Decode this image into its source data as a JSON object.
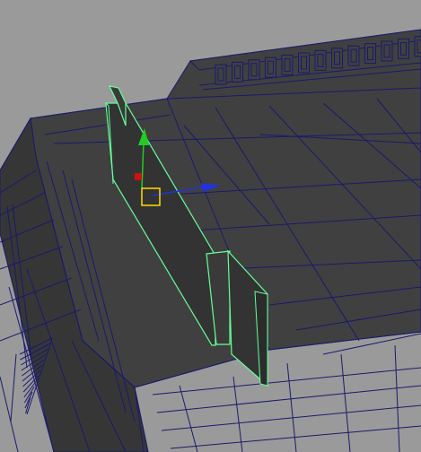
{
  "viewport": {
    "panel": "perspective-viewport",
    "display_mode": "wireframe-on-shaded",
    "colors": {
      "background": "#9a9a9a",
      "surface": "#404040",
      "surface_shadow": "#363636",
      "wireframe": "#1a1a6e",
      "selection_highlight": "#66ff99",
      "manipulator_x": "#2233dd",
      "manipulator_y": "#22cc22",
      "manipulator_z": "#cc1111",
      "pivot_handle": "#ffdd00"
    },
    "selected_objects": [
      "wall-panel-long",
      "wall-panel-short"
    ],
    "icons": [
      "move-manipulator-icon",
      "pivot-handle-icon"
    ]
  }
}
